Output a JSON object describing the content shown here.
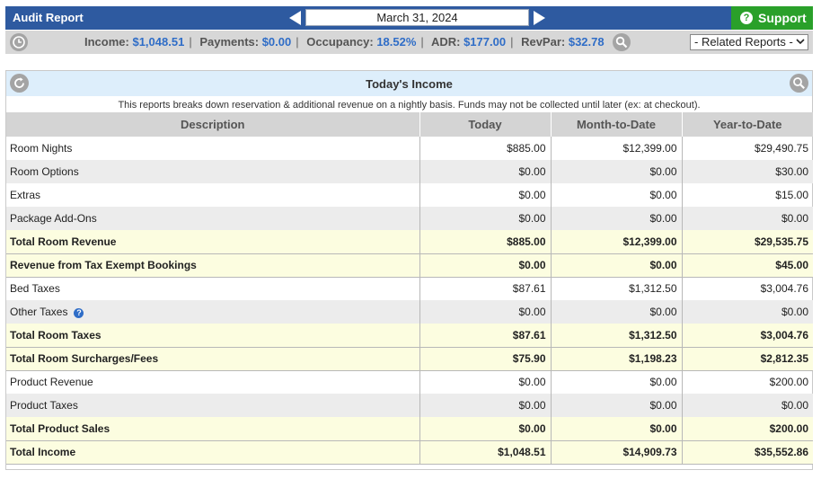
{
  "header": {
    "title": "Audit Report",
    "date": "March 31, 2024",
    "support_label": "Support",
    "support_icon": "question-circle-icon",
    "prev_icon": "arrow-left-icon",
    "next_icon": "arrow-right-icon"
  },
  "stats": {
    "income_label": "Income:",
    "income": "$1,048.51",
    "payments_label": "Payments:",
    "payments": "$0.00",
    "occupancy_label": "Occupancy:",
    "occupancy": "18.52%",
    "adr_label": "ADR:",
    "adr": "$177.00",
    "revpar_label": "RevPar:",
    "revpar": "$32.78",
    "related_reports": "- Related Reports -"
  },
  "panel": {
    "title": "Today's Income",
    "description": "This reports breaks down reservation & additional revenue on a nightly basis. Funds may not be collected until later (ex: at checkout).",
    "columns": [
      "Description",
      "Today",
      "Month-to-Date",
      "Year-to-Date"
    ],
    "rows": [
      {
        "label": "Room Nights",
        "today": "$885.00",
        "mtd": "$12,399.00",
        "ytd": "$29,490.75",
        "type": "normal"
      },
      {
        "label": "Room Options",
        "today": "$0.00",
        "mtd": "$0.00",
        "ytd": "$30.00",
        "type": "alt"
      },
      {
        "label": "Extras",
        "today": "$0.00",
        "mtd": "$0.00",
        "ytd": "$15.00",
        "type": "normal"
      },
      {
        "label": "Package Add-Ons",
        "today": "$0.00",
        "mtd": "$0.00",
        "ytd": "$0.00",
        "type": "alt"
      },
      {
        "label": "Total Room Revenue",
        "today": "$885.00",
        "mtd": "$12,399.00",
        "ytd": "$29,535.75",
        "type": "total"
      },
      {
        "label": "Revenue from Tax Exempt Bookings",
        "today": "$0.00",
        "mtd": "$0.00",
        "ytd": "$45.00",
        "type": "total"
      },
      {
        "label": "Bed Taxes",
        "today": "$87.61",
        "mtd": "$1,312.50",
        "ytd": "$3,004.76",
        "type": "normal"
      },
      {
        "label": "Other Taxes",
        "today": "$0.00",
        "mtd": "$0.00",
        "ytd": "$0.00",
        "type": "alt",
        "info": "?"
      },
      {
        "label": "Total Room Taxes",
        "today": "$87.61",
        "mtd": "$1,312.50",
        "ytd": "$3,004.76",
        "type": "total"
      },
      {
        "label": "Total Room Surcharges/Fees",
        "today": "$75.90",
        "mtd": "$1,198.23",
        "ytd": "$2,812.35",
        "type": "total"
      },
      {
        "label": "Product Revenue",
        "today": "$0.00",
        "mtd": "$0.00",
        "ytd": "$200.00",
        "type": "normal"
      },
      {
        "label": "Product Taxes",
        "today": "$0.00",
        "mtd": "$0.00",
        "ytd": "$0.00",
        "type": "alt"
      },
      {
        "label": "Total Product Sales",
        "today": "$0.00",
        "mtd": "$0.00",
        "ytd": "$200.00",
        "type": "total"
      },
      {
        "label": "Total Income",
        "today": "$1,048.51",
        "mtd": "$14,909.73",
        "ytd": "$35,552.86",
        "type": "total"
      }
    ]
  },
  "colors": {
    "header_bg": "#2e5aa0",
    "support_bg": "#2aa02a",
    "stat_value": "#2f6dc7",
    "total_row_bg": "#fcfde0"
  }
}
